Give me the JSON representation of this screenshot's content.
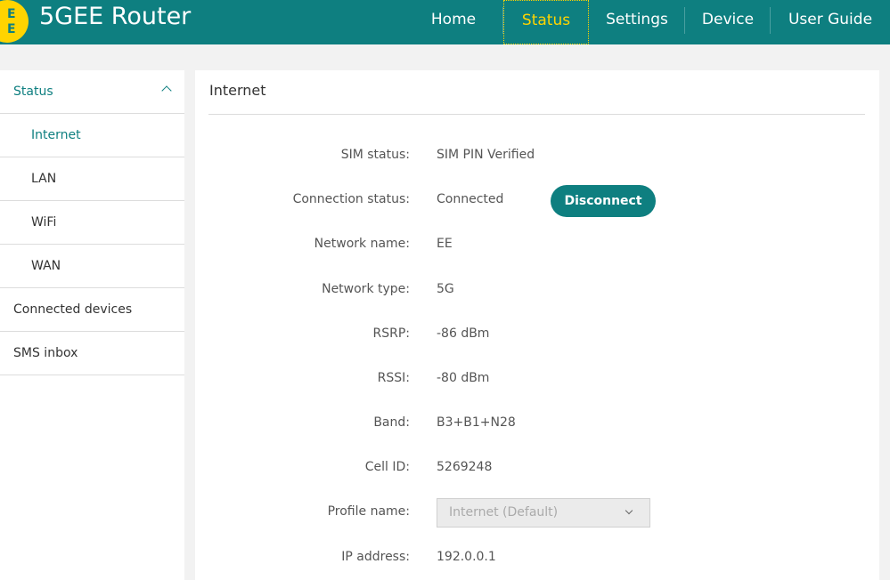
{
  "header": {
    "logo_letters": [
      "E",
      "E"
    ],
    "brand": "5GEE Router",
    "nav": [
      {
        "label": "Home"
      },
      {
        "label": "Status"
      },
      {
        "label": "Settings"
      },
      {
        "label": "Device"
      },
      {
        "label": "User Guide"
      }
    ],
    "active_nav": "Status"
  },
  "sidebar": {
    "items": [
      {
        "label": "Status"
      },
      {
        "label": "Internet"
      },
      {
        "label": "LAN"
      },
      {
        "label": "WiFi"
      },
      {
        "label": "WAN"
      },
      {
        "label": "Connected devices"
      },
      {
        "label": "SMS inbox"
      }
    ]
  },
  "main": {
    "title": "Internet",
    "rows": [
      {
        "label": "SIM status:",
        "value": "SIM PIN Verified"
      },
      {
        "label": "Connection status:",
        "value": "Connected",
        "button": "Disconnect"
      },
      {
        "label": "Network name:",
        "value": "EE"
      },
      {
        "label": "Network type:",
        "value": "5G"
      },
      {
        "label": "RSRP:",
        "value": "-86 dBm"
      },
      {
        "label": "RSSI:",
        "value": "-80 dBm"
      },
      {
        "label": "Band:",
        "value": "B3+B1+N28"
      },
      {
        "label": "Cell ID:",
        "value": "5269248"
      },
      {
        "label": "Profile name:",
        "value": "Internet (Default)"
      },
      {
        "label": "IP address:",
        "value": "192.0.0.1"
      }
    ]
  },
  "colors": {
    "brand_teal": "#0e7f80",
    "accent_yellow": "#ffd400",
    "background": "#f2f2f2"
  }
}
